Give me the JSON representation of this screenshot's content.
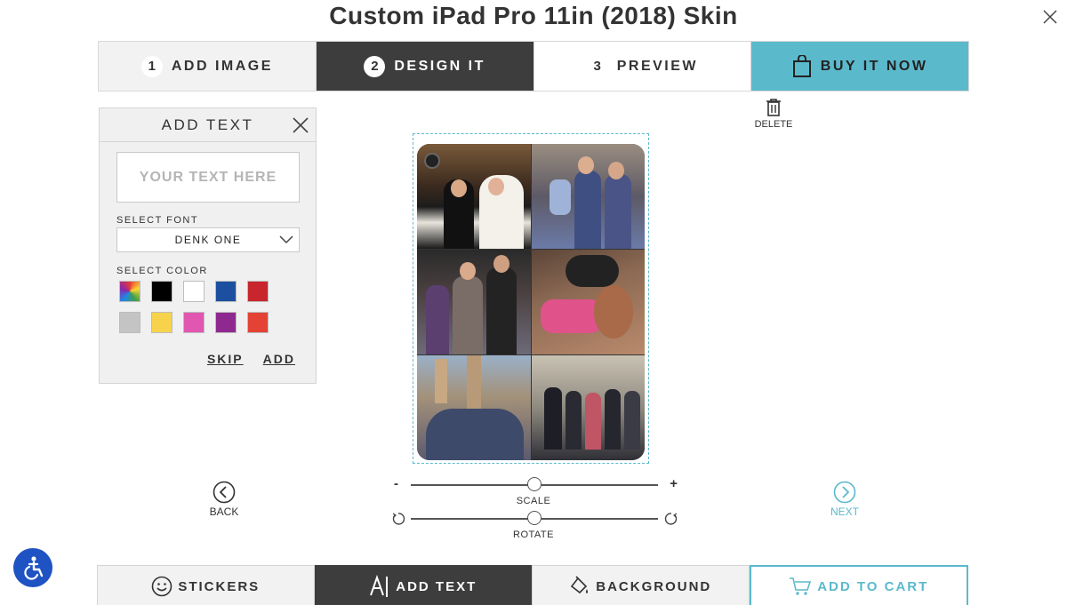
{
  "page_title": "Custom iPad Pro 11in (2018) Skin",
  "steps": [
    {
      "num": "1",
      "label": "ADD IMAGE"
    },
    {
      "num": "2",
      "label": "DESIGN IT"
    },
    {
      "num": "3",
      "label": "PREVIEW"
    },
    {
      "label": "BUY IT NOW"
    }
  ],
  "delete_label": "DELETE",
  "add_text_panel": {
    "title": "ADD TEXT",
    "text_placeholder": "YOUR TEXT HERE",
    "font_label": "SELECT FONT",
    "font_value": "DENK ONE",
    "color_label": "SELECT COLOR",
    "colors": [
      "rainbow",
      "#000000",
      "#ffffff",
      "#1c4fa0",
      "#c9252c",
      "#c4c4c4",
      "#f7d24b",
      "#e056b0",
      "#8e2a8f",
      "#e34234"
    ],
    "skip_label": "SKIP",
    "add_label": "ADD"
  },
  "controls": {
    "scale_label": "SCALE",
    "rotate_label": "ROTATE",
    "minus": "-",
    "plus": "+",
    "scale_level": 0.5,
    "rotate_level": 0.5
  },
  "nav": {
    "back_label": "BACK",
    "next_label": "NEXT"
  },
  "toolbar": {
    "stickers_label": "STICKERS",
    "add_text_label": "ADD TEXT",
    "background_label": "BACKGROUND",
    "add_to_cart_label": "ADD TO CART"
  },
  "colors": {
    "accent": "#5bb9cc",
    "dark": "#3d3d3d",
    "a11y_blue": "#1f52c2"
  }
}
